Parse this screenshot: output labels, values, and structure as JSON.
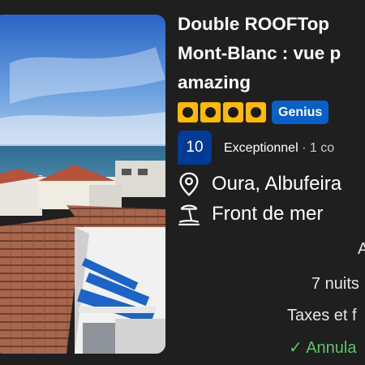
{
  "listing": {
    "title_line1": "Double ROOFTop",
    "title_line2": "Mont-Blanc : vue p",
    "title_line3": "amazing",
    "genius_label": "Genius",
    "rating_stars": 4,
    "score": "10",
    "review_word": "Exceptionnel",
    "review_count": " · 1 co",
    "location": "Oura, Albufeira",
    "beach": "Front de mer",
    "price_header_partial": "A",
    "nights": "7 nuits",
    "taxes": "Taxes et f",
    "cancellation": "✓ Annula"
  },
  "colors": {
    "background": "#1f1f1f",
    "star": "#febb02",
    "genius": "#0a5ec9",
    "score": "#003b95",
    "cancellation": "#5bc46b"
  },
  "icons": [
    "map-pin-icon",
    "beach-umbrella-icon",
    "star-icon"
  ]
}
